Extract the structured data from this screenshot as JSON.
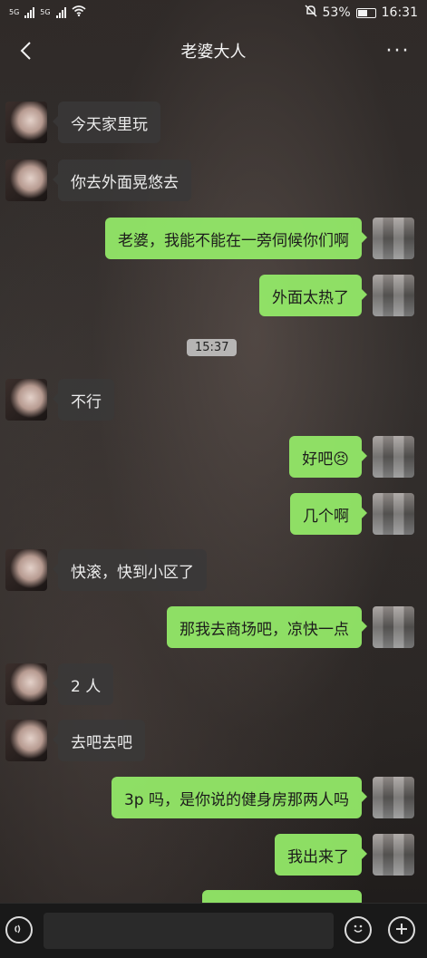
{
  "status": {
    "net1": "5G",
    "net2": "5G",
    "battery_percent": "53%",
    "time": "16:31"
  },
  "header": {
    "title": "老婆大人",
    "more": "···"
  },
  "timestamps": [
    "15:37"
  ],
  "messages": [
    {
      "side": "in",
      "text": "今天家里玩"
    },
    {
      "side": "in",
      "text": "你去外面晃悠去"
    },
    {
      "side": "out",
      "text": "老婆，我能不能在一旁伺候你们啊"
    },
    {
      "side": "out",
      "text": "外面太热了"
    },
    {
      "side": "in",
      "text": "不行"
    },
    {
      "side": "out",
      "text": "好吧😣"
    },
    {
      "side": "out",
      "text": "几个啊"
    },
    {
      "side": "in",
      "text": "快滚，快到小区了"
    },
    {
      "side": "out",
      "text": "那我去商场吧，凉快一点"
    },
    {
      "side": "in",
      "text": "2 人"
    },
    {
      "side": "in",
      "text": "去吧去吧"
    },
    {
      "side": "out",
      "text": "3p 吗，是你说的健身房那两人吗"
    },
    {
      "side": "out",
      "text": "我出来了"
    }
  ],
  "colors": {
    "out_bubble": "#95ec69",
    "in_bubble": "#3a3838",
    "bottom_bar": "#191919"
  },
  "icons": {
    "back": "chevron-left-icon",
    "more": "more-dots-icon",
    "voice": "voice-icon",
    "emoji": "emoji-icon",
    "plus": "plus-icon"
  }
}
